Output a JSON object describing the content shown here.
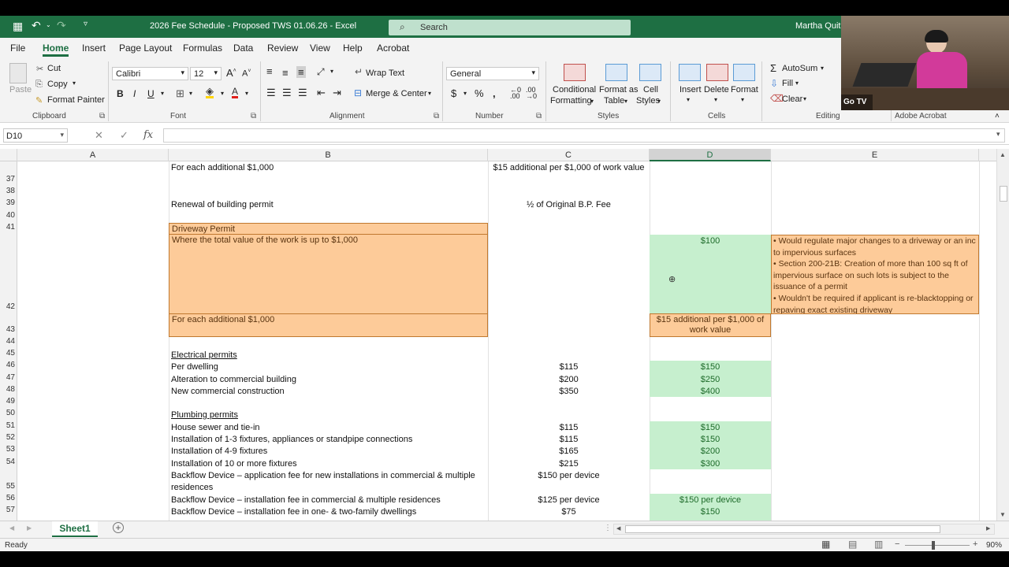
{
  "window": {
    "title": "2026 Fee Schedule - Proposed TWS 01.06.26  -  Excel",
    "user": "Martha Quitu",
    "search_placeholder": "Search"
  },
  "menu": [
    "File",
    "Home",
    "Insert",
    "Page Layout",
    "Formulas",
    "Data",
    "Review",
    "View",
    "Help",
    "Acrobat"
  ],
  "ribbon": {
    "clipboard": {
      "paste": "Paste",
      "cut": "Cut",
      "copy": "Copy",
      "format_painter": "Format Painter",
      "group": "Clipboard"
    },
    "font": {
      "name": "Calibri",
      "size": "12",
      "group": "Font"
    },
    "alignment": {
      "wrap": "Wrap Text",
      "merge": "Merge & Center",
      "group": "Alignment"
    },
    "number": {
      "format": "General",
      "group": "Number"
    },
    "styles": {
      "conditional": "Conditional",
      "formatting": "Formatting",
      "format_as": "Format as",
      "table": "Table",
      "cell": "Cell",
      "styles_lbl": "Styles",
      "group": "Styles"
    },
    "cells": {
      "insert": "Insert",
      "delete": "Delete",
      "format": "Format",
      "group": "Cells"
    },
    "editing": {
      "autosum": "AutoSum",
      "fill": "Fill",
      "clear": "Clear",
      "group": "Editing"
    },
    "acrobat": {
      "group": "Adobe Acrobat"
    }
  },
  "formula_bar": {
    "name_box": "D10",
    "value": ""
  },
  "columns": [
    "A",
    "B",
    "C",
    "D",
    "E"
  ],
  "rows": {
    "r37": {
      "num": "37",
      "b": "For each additional $1,000",
      "c": "$15 additional per $1,000 of work value"
    },
    "r38": {
      "num": "38"
    },
    "r39": {
      "num": "39",
      "b": "Renewal of building permit",
      "c": "½ of Original B.P. Fee"
    },
    "r40": {
      "num": "40"
    },
    "r41": {
      "num": "41",
      "b": "Driveway Permit"
    },
    "r42": {
      "num": "42",
      "b": "Where the total value of the work is up to $1,000",
      "d": "$100",
      "e1": "• Would regulate major changes to a driveway or an inc",
      "e2": "to impervious surfaces",
      "e3": "• Section 200-21B: Creation of more than 100 sq ft of",
      "e4": "impervious surface on such lots is subject to the",
      "e5": "issuance of a permit",
      "e6": "• Wouldn't be required if applicant is re-blacktopping or",
      "e7": "repaving exact existing driveway"
    },
    "r43": {
      "num": "43",
      "b": "For each additional $1,000",
      "d1": "$15 additional per $1,000 of",
      "d2": "work value"
    },
    "r44": {
      "num": "44"
    },
    "r45": {
      "num": "45",
      "b": "Electrical permits"
    },
    "r46": {
      "num": "46",
      "b": "Per dwelling",
      "c": "$115",
      "d": "$150"
    },
    "r47": {
      "num": "47",
      "b": "Alteration to commercial building",
      "c": "$200",
      "d": "$250"
    },
    "r48": {
      "num": "48",
      "b": "New commercial construction",
      "c": "$350",
      "d": "$400"
    },
    "r49": {
      "num": "49"
    },
    "r50": {
      "num": "50",
      "b": "Plumbing permits"
    },
    "r51": {
      "num": "51",
      "b": "House sewer and tie-in",
      "c": "$115",
      "d": "$150"
    },
    "r52": {
      "num": "52",
      "b": "Installation of 1-3 fixtures, appliances or standpipe connections",
      "c": "$115",
      "d": "$150"
    },
    "r53": {
      "num": "53",
      "b": "Installation of 4-9 fixtures",
      "c": "$165",
      "d": "$200"
    },
    "r54": {
      "num": "54",
      "b": "Installation of 10 or more fixtures",
      "c": "$215",
      "d": "$300"
    },
    "r55": {
      "num": "55",
      "b1": "Backflow Device – application fee for new installations in commercial & multiple",
      "b2": "residences",
      "c": "$150 per device"
    },
    "r56": {
      "num": "56",
      "b": "Backflow Device – installation fee in commercial & multiple residences",
      "c": "$125 per device",
      "d": "$150 per device"
    },
    "r57": {
      "num": "57",
      "b": "Backflow Device – installation fee in one- & two-family dwellings",
      "c": "$75",
      "d": "$150"
    }
  },
  "sheet_tab": "Sheet1",
  "status": {
    "ready": "Ready",
    "zoom": "90%"
  },
  "webcam": {
    "label": "Go TV"
  },
  "colors": {
    "excel_green": "#1e6f43",
    "orange_fill": "#fdcb99",
    "green_fill": "#c6efce"
  }
}
